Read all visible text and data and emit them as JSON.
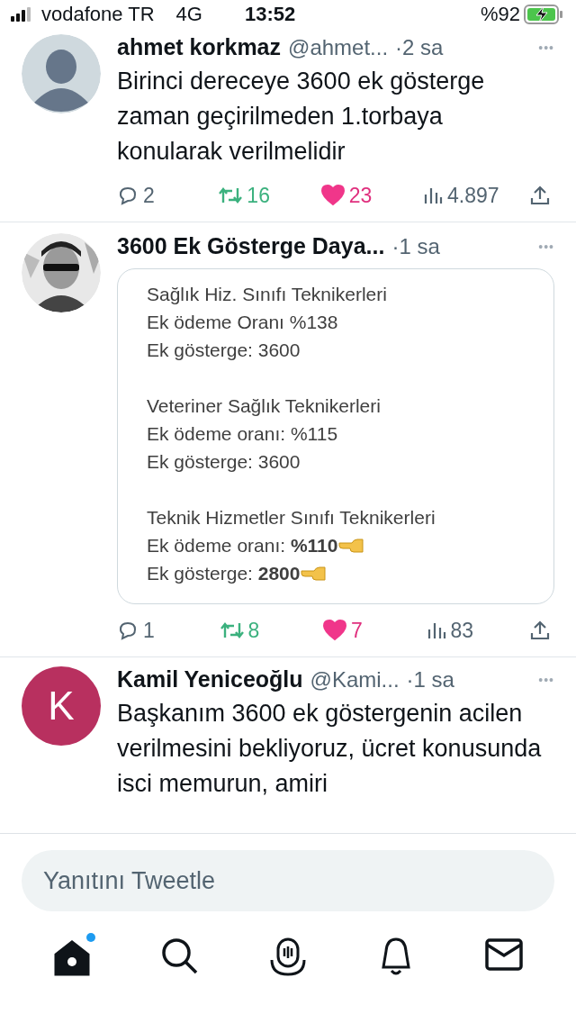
{
  "status_bar": {
    "carrier": "vodafone TR",
    "network": "4G",
    "time": "13:52",
    "battery": "%92"
  },
  "tweets": [
    {
      "avatar": {
        "kind": "default"
      },
      "name": "ahmet korkmaz",
      "handle": "@ahmet...",
      "time": "·2 sa",
      "more": "•••",
      "text": [
        "Birinci dereceye 3600 ek gösterge zaman geçirilmeden 1.torbaya konularak verilmelidir"
      ],
      "replies": "2",
      "retweets": "16",
      "retweeted": true,
      "likes": "23",
      "liked": true,
      "views": "4.897"
    },
    {
      "name": "3600 Ek Gösterge Daya...",
      "time": "·1 sa",
      "more": "•••",
      "card": {
        "groups": [
          {
            "lines": [
              {
                "text": "Sağlık Hiz. Sınıfı Teknikerleri",
                "pointer": false
              },
              {
                "text": "Ek ödeme Oranı %138",
                "pointer": false
              },
              {
                "text": "Ek gösterge: 3600",
                "pointer": false
              }
            ]
          },
          {
            "lines": [
              {
                "text": "Veteriner Sağlık Teknikerleri",
                "pointer": false
              },
              {
                "text": "Ek ödeme oranı: %115",
                "pointer": false
              },
              {
                "text": "Ek gösterge: 3600",
                "pointer": false
              }
            ]
          },
          {
            "lines": [
              {
                "text": "Teknik Hizmetler Sınıfı Teknikerleri",
                "pointer": false
              },
              {
                "text": "Ek ödeme oranı: **%110**",
                "pointer": true
              },
              {
                "text": "Ek gösterge: **2800**",
                "pointer": true
              }
            ]
          }
        ]
      },
      "replies": "1",
      "retweets": "8",
      "retweeted": true,
      "likes": "7",
      "liked": true,
      "views": "83"
    },
    {
      "avatar": {
        "kind": "letter",
        "letter": "K",
        "color": "#b8305f"
      },
      "name": "Kamil Yeniceoğlu",
      "handle": "@Kami...",
      "time": "·1 sa",
      "more": "•••",
      "text": [
        "Başkanım 3600 ek göstergenin acilen verilmesini bekliyoruz, ücret konusunda  isci memurun, amiri"
      ]
    }
  ],
  "reply_bar": {
    "placeholder": "Yanıtını Tweetle"
  },
  "tab_bar": [
    {
      "kind": "home",
      "selected": true,
      "new": true
    },
    {
      "kind": "search",
      "selected": false,
      "new": false
    },
    {
      "kind": "spaces",
      "selected": false,
      "new": false
    },
    {
      "kind": "notifications",
      "selected": false,
      "new": false
    },
    {
      "kind": "messages",
      "selected": false,
      "new": false
    }
  ]
}
